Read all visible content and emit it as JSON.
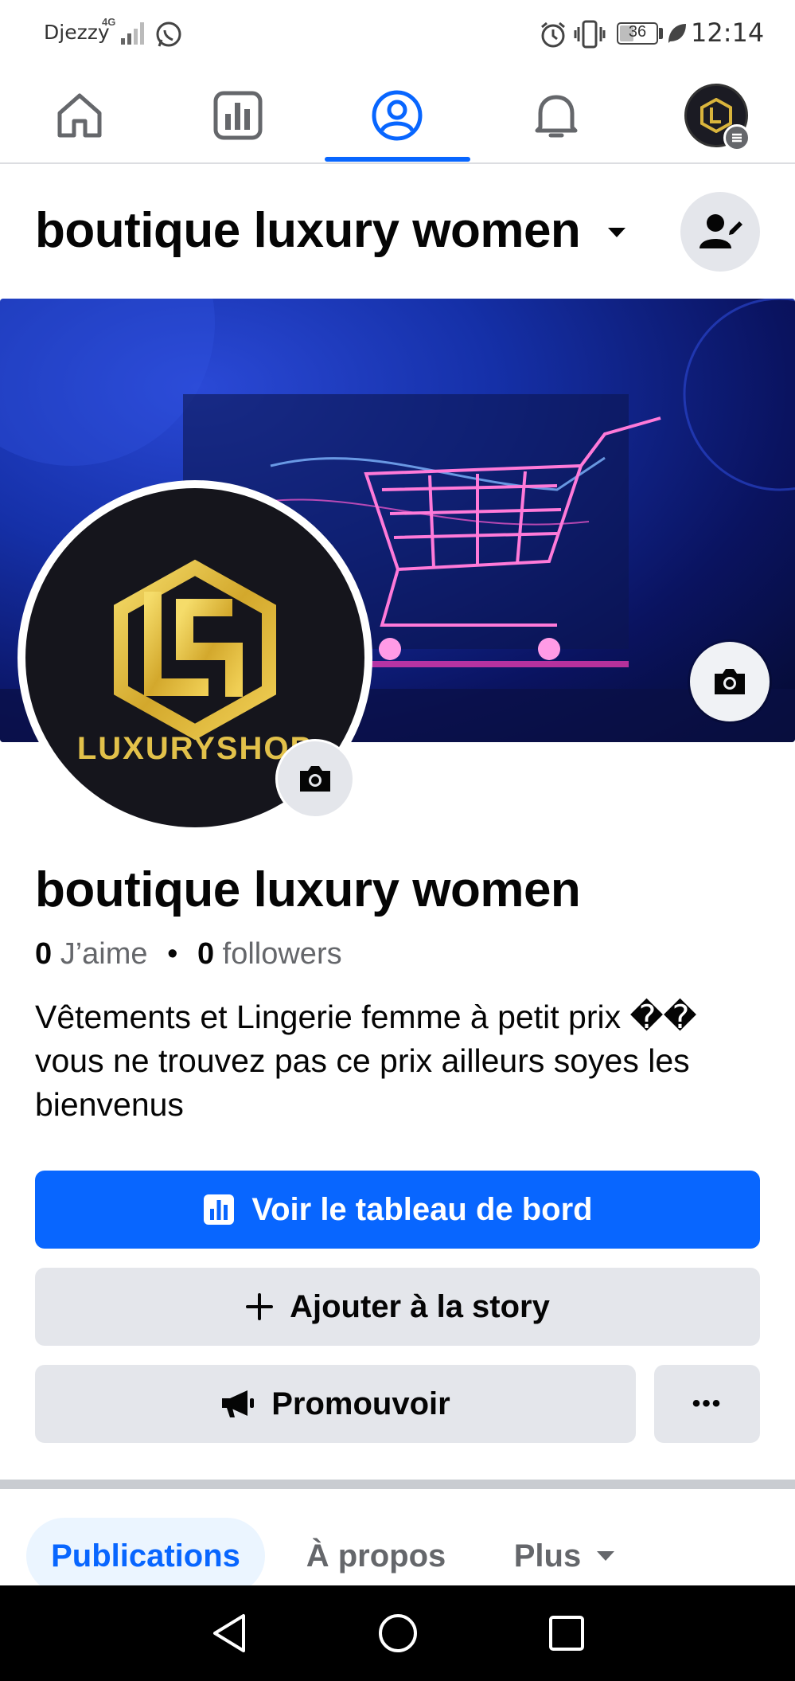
{
  "status_bar": {
    "carrier": "Djezzy",
    "network": "4G",
    "battery": "36",
    "battery_level": 0.36,
    "time": "12:14"
  },
  "nav": {
    "items": [
      {
        "name": "home",
        "icon": "home-icon"
      },
      {
        "name": "dashboard",
        "icon": "bar-chart-icon"
      },
      {
        "name": "profile",
        "icon": "profile-icon",
        "active": true
      },
      {
        "name": "notifications",
        "icon": "bell-icon"
      },
      {
        "name": "menu",
        "icon": "avatar-menu-icon"
      }
    ],
    "accent": "#0866ff"
  },
  "header": {
    "title": "boutique luxury women"
  },
  "avatar": {
    "brand_text": "LUXURYSHOP"
  },
  "profile": {
    "name": "boutique luxury women",
    "likes_count": "0",
    "likes_label": "J’aime",
    "separator": "•",
    "followers_count": "0",
    "followers_label": "followers",
    "bio": "Vêtements et Lingerie femme à petit prix �� vous ne trouvez pas ce prix ailleurs soyes les bienvenus"
  },
  "buttons": {
    "dashboard": "Voir le tableau de bord",
    "story": "Ajouter à la story",
    "promote": "Promouvoir",
    "more": "•••"
  },
  "tabs": {
    "posts": "Publications",
    "about": "À propos",
    "more": "Plus"
  }
}
